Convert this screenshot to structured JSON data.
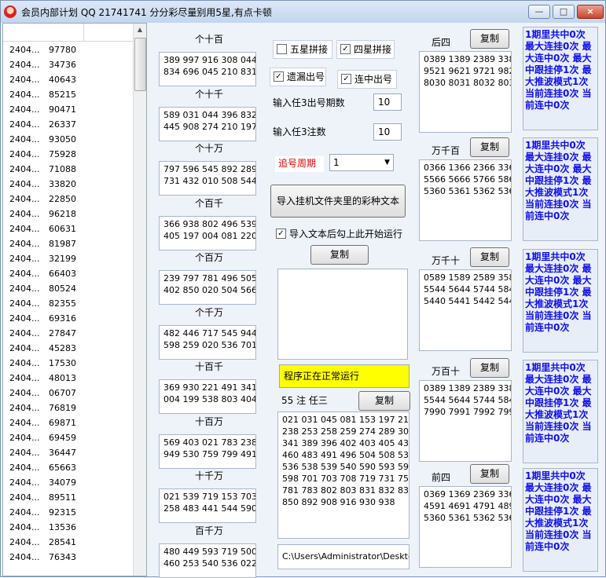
{
  "window": {
    "title": "会员内部计划 QQ 21741741 分分彩尽量别用5星,有点卡顿",
    "controls": {
      "minimize": "—",
      "maximize": "□",
      "close": "×"
    }
  },
  "list": {
    "rows": [
      {
        "issue": "2404...",
        "code": "97780"
      },
      {
        "issue": "2404...",
        "code": "34736"
      },
      {
        "issue": "2404...",
        "code": "40643"
      },
      {
        "issue": "2404...",
        "code": "85215"
      },
      {
        "issue": "2404...",
        "code": "90471"
      },
      {
        "issue": "2404...",
        "code": "26337"
      },
      {
        "issue": "2404...",
        "code": "93050"
      },
      {
        "issue": "2404...",
        "code": "75928"
      },
      {
        "issue": "2404...",
        "code": "71088"
      },
      {
        "issue": "2404...",
        "code": "33820"
      },
      {
        "issue": "2404...",
        "code": "22850"
      },
      {
        "issue": "2404...",
        "code": "96218"
      },
      {
        "issue": "2404...",
        "code": "60631"
      },
      {
        "issue": "2404...",
        "code": "81987"
      },
      {
        "issue": "2404...",
        "code": "32199"
      },
      {
        "issue": "2404...",
        "code": "66403"
      },
      {
        "issue": "2404...",
        "code": "80524"
      },
      {
        "issue": "2404...",
        "code": "82355"
      },
      {
        "issue": "2404...",
        "code": "69316"
      },
      {
        "issue": "2404...",
        "code": "27847"
      },
      {
        "issue": "2404...",
        "code": "45283"
      },
      {
        "issue": "2404...",
        "code": "17530"
      },
      {
        "issue": "2404...",
        "code": "48013"
      },
      {
        "issue": "2404...",
        "code": "06707"
      },
      {
        "issue": "2404...",
        "code": "76819"
      },
      {
        "issue": "2404...",
        "code": "69871"
      },
      {
        "issue": "2404...",
        "code": "69459"
      },
      {
        "issue": "2404...",
        "code": "36447"
      },
      {
        "issue": "2404...",
        "code": "65663"
      },
      {
        "issue": "2404...",
        "code": "34079"
      },
      {
        "issue": "2404...",
        "code": "89511"
      },
      {
        "issue": "2404...",
        "code": "92315"
      },
      {
        "issue": "2404...",
        "code": "13536"
      },
      {
        "issue": "2404...",
        "code": "28541"
      },
      {
        "issue": "2404...",
        "code": "76343"
      }
    ]
  },
  "groups": [
    {
      "label": "个十百",
      "numbers": "389 997 916 308 044\n834 696 045 210 831"
    },
    {
      "label": "个十千",
      "numbers": "589 031 044 396 832\n445 908 274 210 197"
    },
    {
      "label": "个十万",
      "numbers": "797 596 545 892 289\n731 432 010 508 544"
    },
    {
      "label": "个百千",
      "numbers": "366 938 802 496 539\n405 197 004 081 220"
    },
    {
      "label": "个百万",
      "numbers": "239 797 781 496 505\n402 850 020 504 566"
    },
    {
      "label": "个千万",
      "numbers": "482 446 717 545 944\n598 259 020 536 701"
    },
    {
      "label": "十百千",
      "numbers": "369 930 221 491 341\n004 199 538 803 404"
    },
    {
      "label": "十百万",
      "numbers": "569 403 021 783 238\n949 530 759 799 491"
    },
    {
      "label": "十千万",
      "numbers": "021 539 719 153 703\n258 483 441 544 590"
    },
    {
      "label": "百千万",
      "numbers": "480 449 593 719 500\n460 253 540 536 022"
    }
  ],
  "options": {
    "five_star_label": "五星拼接",
    "five_star_checked": "",
    "four_star_label": "四星拼接",
    "four_star_checked": "✓",
    "miss_label": "遗漏出号",
    "miss_checked": "✓",
    "hit_label": "连中出号",
    "hit_checked": "✓",
    "issues_label": "输入任3出号期数",
    "issues_value": "10",
    "notes_label": "输入任3注数",
    "notes_value": "10",
    "cycle_label": "追号周期",
    "cycle_value": "1",
    "import_button": "导入挂机文件夹里的彩种文本",
    "auto_run_label": "导入文本后勾上此开始运行",
    "auto_run_checked": "✓",
    "copy_label": "复制"
  },
  "status_text": "程序正在正常运行",
  "ren3": {
    "count_label": "55 注 任三",
    "numbers": "021 031 045 081 153 197 210\n238 253 258 259 274 289 308\n341 389 396 402 403 405 432\n460 483 491 496 504 508 530\n536 538 539 540 590 593 596\n598 701 703 708 719 731 759\n781 783 802 803 831 832 834\n850 892 908 916 930 938"
  },
  "path_text": "C:\\Users\\Administrator\\Desktc",
  "four_star": [
    {
      "label": "后四",
      "numbers": "0389 1389 2389 3389\n9521 9621 9721 9821\n8030 8031 8032 8033"
    },
    {
      "label": "万千百",
      "numbers": "0366 1366 2366 3366\n5566 5666 5766 5866\n5360 5361 5362 5363"
    },
    {
      "label": "万千十",
      "numbers": "0589 1589 2589 3589\n5544 5644 5744 5844\n5440 5441 5442 5443"
    },
    {
      "label": "万百十",
      "numbers": "0389 1389 2389 3389\n5544 5644 5744 5844\n7990 7991 7992 7993"
    },
    {
      "label": "前四",
      "numbers": "0369 1369 2369 3369\n4591 4691 4791 4891\n5360 5361 5362 5363"
    }
  ],
  "stats": [
    "1期里共中0次 最大连挂0次 最大连中0次 最大中跟挂停1次 最大推波模式1次 当前连挂0次 当前连中0次",
    "1期里共中0次 最大连挂0次 最大连中0次 最大中跟挂停1次 最大推波模式1次 当前连挂0次 当前连中0次",
    "1期里共中0次 最大连挂0次 最大连中0次 最大中跟挂停1次 最大推波模式1次 当前连挂0次 当前连中0次",
    "1期里共中0次 最大连挂0次 最大连中0次 最大中跟挂停1次 最大推波模式1次 当前连挂0次 当前连中0次",
    "1期里共中0次 最大连挂0次 最大连中0次 最大中跟挂停1次 最大推波模式1次 当前连挂0次 当前连中0次"
  ],
  "colors": {
    "stat_text": "#1010ee",
    "status_bg": "#ffff00",
    "cycle_label": "#e00000"
  }
}
